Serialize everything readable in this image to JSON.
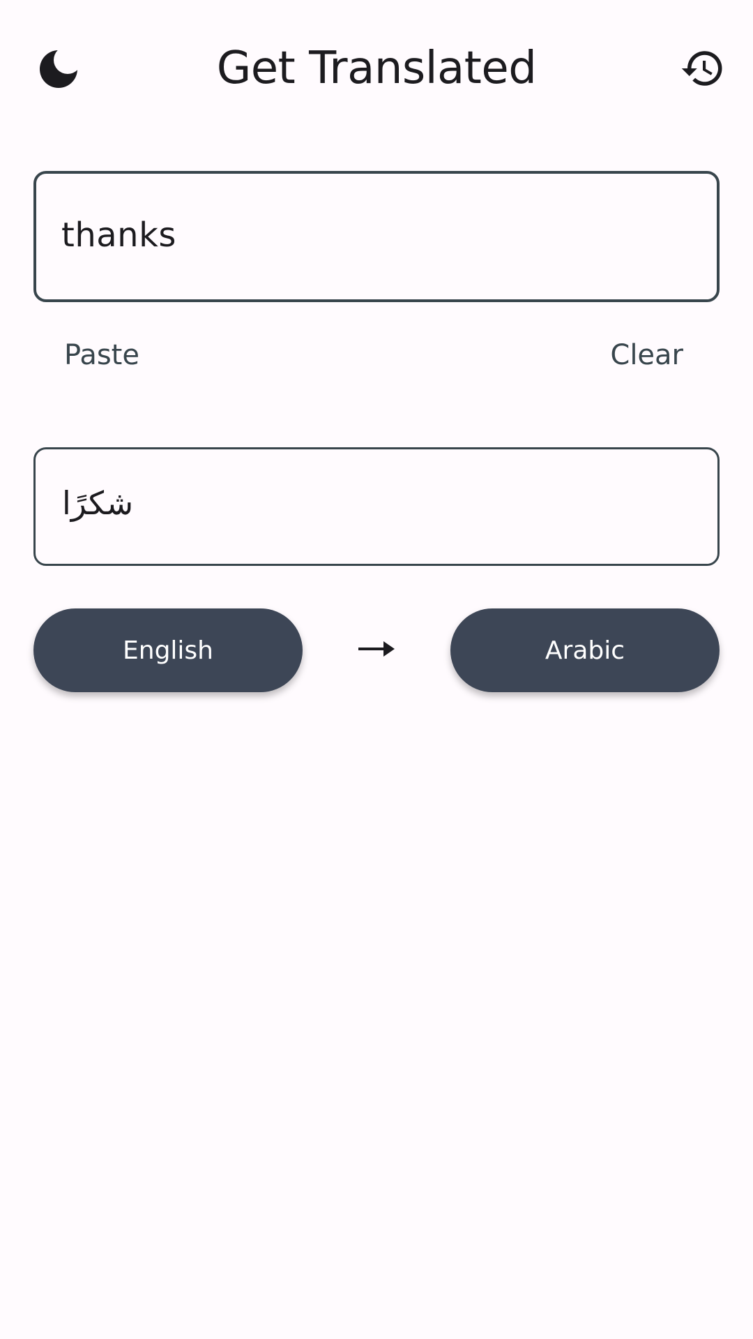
{
  "app_bar": {
    "title": "Get Translated",
    "left_icon": "moon-icon",
    "right_icon": "history-icon"
  },
  "input": {
    "value": "thanks"
  },
  "actions": {
    "paste_label": "Paste",
    "clear_label": "Clear"
  },
  "output": {
    "value": "شكرًا"
  },
  "languages": {
    "source": "English",
    "target": "Arabic",
    "direction_icon": "arrow-right-icon"
  },
  "colors": {
    "background": "#fffbfe",
    "outline": "#38454c",
    "button_fill": "#3d4656",
    "button_text": "#ffffff"
  }
}
